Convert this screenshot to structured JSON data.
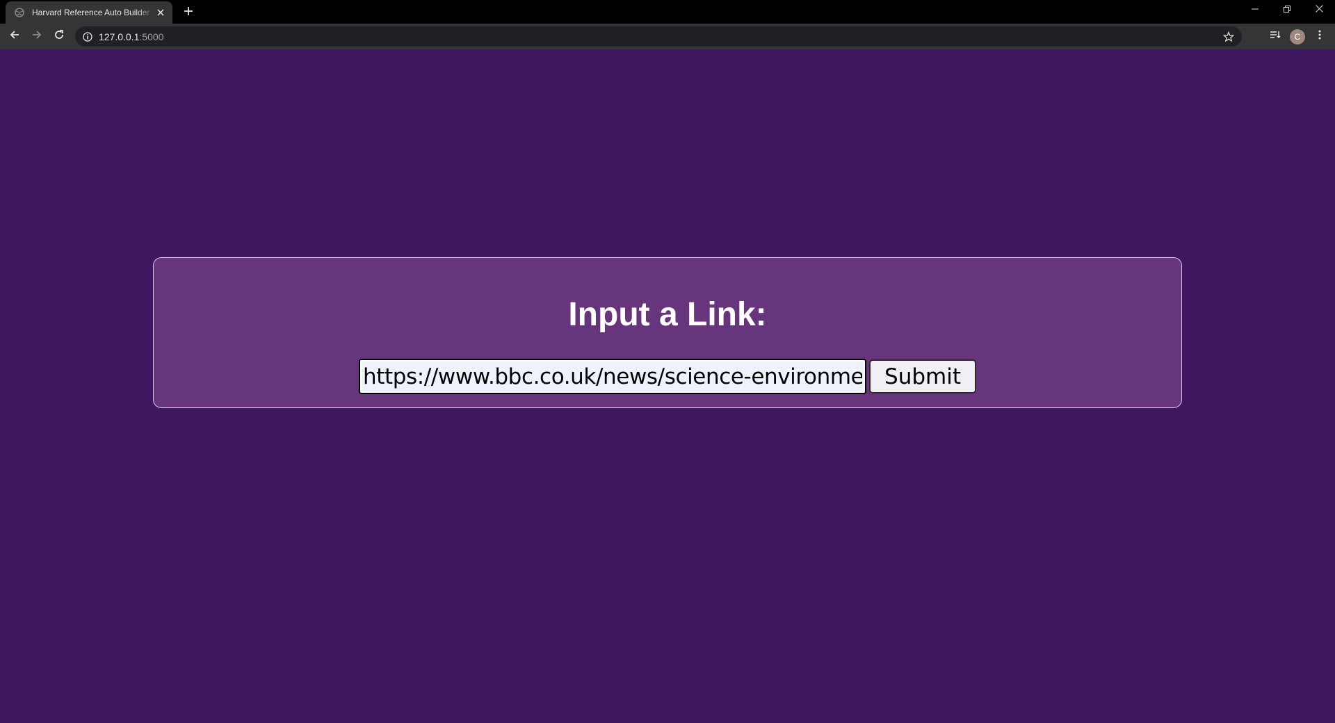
{
  "browser": {
    "tab_title": "Harvard Reference Auto Builder",
    "url_host": "127.0.0.1",
    "url_port": ":5000",
    "avatar_letter": "C",
    "icons": [
      "globe-icon",
      "close-icon",
      "plus-icon",
      "minimize-icon",
      "restore-icon",
      "back-icon",
      "forward-icon",
      "reload-icon",
      "info-icon",
      "star-icon",
      "reading-list-icon",
      "kebab-menu-icon"
    ]
  },
  "page": {
    "heading": "Input a Link:",
    "link_input_value": "https://www.bbc.co.uk/news/science-environment-",
    "submit_label": "Submit"
  },
  "colors": {
    "page_background": "#3f1760",
    "card_background": "#66357b",
    "heading_text": "#ffffff"
  }
}
